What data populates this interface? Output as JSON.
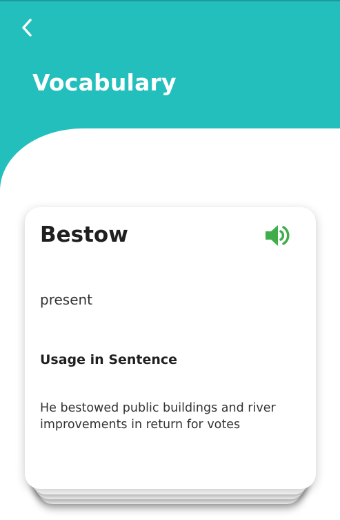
{
  "header": {
    "title": "Vocabulary",
    "back_icon": "chevron-left-icon",
    "color": "#22bfbd"
  },
  "card": {
    "word": "Bestow",
    "meaning": "present",
    "usage_heading": "Usage in Sentence",
    "sentence": "He bestowed public buildings and river improvements in return for votes",
    "speaker_icon": "speaker-icon",
    "speaker_color": "#3fae4a"
  }
}
